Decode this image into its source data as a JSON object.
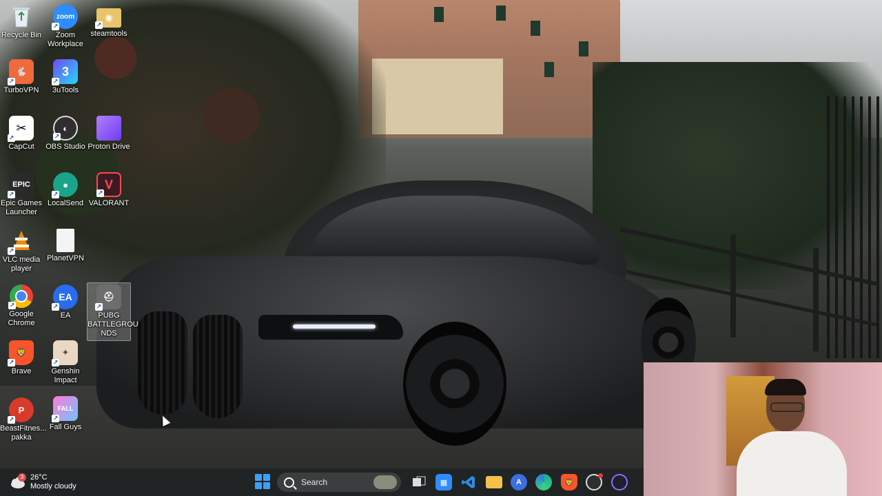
{
  "desktop": {
    "icons": [
      {
        "label": "Recycle Bin",
        "icon": "recycle-bin-icon",
        "color": "#e8eef5"
      },
      {
        "label": "Zoom\nWorkplace",
        "icon": "zoom-icon",
        "color": "#2d8cff"
      },
      {
        "label": "steamtools",
        "icon": "folder-icon",
        "color": "#e9c46a"
      },
      {
        "label": "TurboVPN",
        "icon": "turbovpn-icon",
        "color": "#f06a3c"
      },
      {
        "label": "3uTools",
        "icon": "3utools-icon",
        "color": "#6c4cf0"
      },
      {
        "label": "CapCut",
        "icon": "capcut-icon",
        "color": "#111111"
      },
      {
        "label": "OBS Studio",
        "icon": "obs-icon",
        "color": "#302e31"
      },
      {
        "label": "Proton Drive",
        "icon": "folder-icon",
        "color": "#8a4dff"
      },
      {
        "label": "Epic Games\nLauncher",
        "icon": "epic-games-icon",
        "color": "#2a2a2a"
      },
      {
        "label": "LocalSend",
        "icon": "localsend-icon",
        "color": "#1aa58a"
      },
      {
        "label": "VALORANT",
        "icon": "valorant-icon",
        "color": "#ff4655"
      },
      {
        "label": "VLC media\nplayer",
        "icon": "vlc-icon",
        "color": "#f08a00"
      },
      {
        "label": "PlanetVPN",
        "icon": "file-icon",
        "color": "#f4f4f4"
      },
      {
        "label": "Google\nChrome",
        "icon": "chrome-icon",
        "color": "#4285f4"
      },
      {
        "label": "EA",
        "icon": "ea-icon",
        "color": "#2a6cf0"
      },
      {
        "label": "PUBG\nBATTLEGROU\nNDS",
        "icon": "pubg-icon",
        "color": "#7a7a7a"
      },
      {
        "label": "Brave",
        "icon": "brave-icon",
        "color": "#fb542b"
      },
      {
        "label": "Genshin\nImpact",
        "icon": "genshin-icon",
        "color": "#e9d8c4"
      },
      {
        "label": "BeastFitnes...\npakka",
        "icon": "beastfitness-icon",
        "color": "#d83b2b"
      },
      {
        "label": "Fall Guys",
        "icon": "fall-guys-icon",
        "color": "#6fc3ff"
      }
    ]
  },
  "taskbar": {
    "weather": {
      "badge": "3",
      "temp": "26°C",
      "condition": "Mostly cloudy"
    },
    "search_label": "Search",
    "apps": [
      {
        "name": "task-view",
        "color": "#dcdcdc"
      },
      {
        "name": "microsoft-store",
        "color": "#2f8cff"
      },
      {
        "name": "vscode",
        "color": "#2a8ee6"
      },
      {
        "name": "file-explorer",
        "color": "#f2c14e"
      },
      {
        "name": "app-a",
        "color": "#3b6fe0"
      },
      {
        "name": "edge",
        "color": "#1fa8a0"
      },
      {
        "name": "brave",
        "color": "#fb542b"
      },
      {
        "name": "chatgpt",
        "color": "#2f2f2f"
      },
      {
        "name": "app-circle",
        "color": "#5b3fd6"
      }
    ]
  }
}
